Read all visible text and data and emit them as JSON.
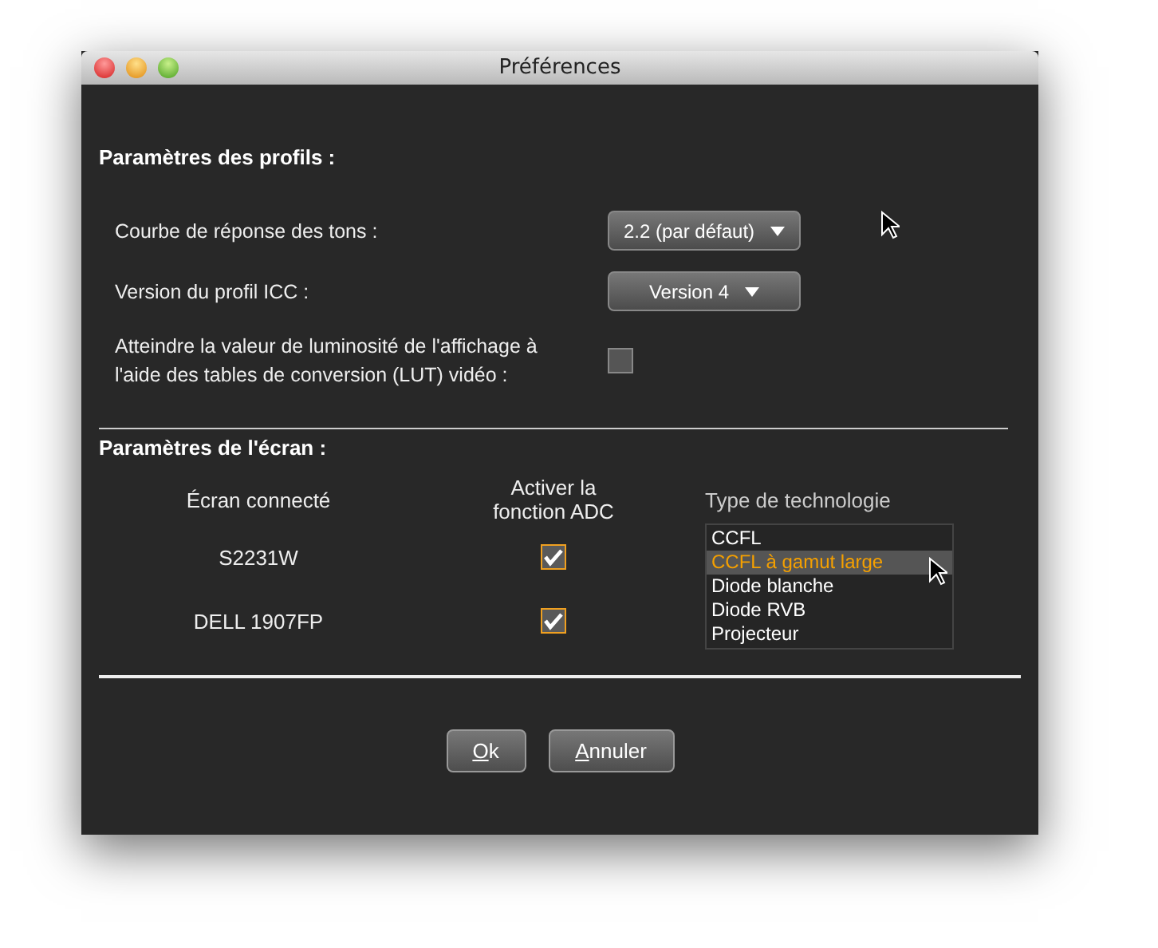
{
  "window": {
    "title": "Préférences"
  },
  "profiles": {
    "heading": "Paramètres des profils :",
    "settings": [
      {
        "kind": "dropdown",
        "label": "Courbe de réponse des tons :",
        "value": "2.2 (par défaut)"
      },
      {
        "kind": "dropdown",
        "label": "Version du profil ICC :",
        "value": "Version 4"
      },
      {
        "kind": "checkbox",
        "label": "Atteindre la valeur de luminosité de l'affichage à l'aide des tables de conversion (LUT) vidéo :",
        "checked": false
      }
    ]
  },
  "screen": {
    "heading": "Paramètres de l'écran :",
    "columns": [
      "Écran connecté",
      "Activer la fonction ADC",
      "Type de technologie"
    ],
    "monitors": [
      {
        "name": "S2231W",
        "adc": true
      },
      {
        "name": "DELL 1907FP",
        "adc": true
      }
    ],
    "technologies": [
      {
        "label": "CCFL",
        "selected": false
      },
      {
        "label": "CCFL à gamut large",
        "selected": true
      },
      {
        "label": "Diode blanche",
        "selected": false
      },
      {
        "label": "Diode RVB",
        "selected": false
      },
      {
        "label": "Projecteur",
        "selected": false
      }
    ]
  },
  "buttons": [
    {
      "accel": "O",
      "rest": "k"
    },
    {
      "accel": "A",
      "rest": "nnuler"
    }
  ]
}
